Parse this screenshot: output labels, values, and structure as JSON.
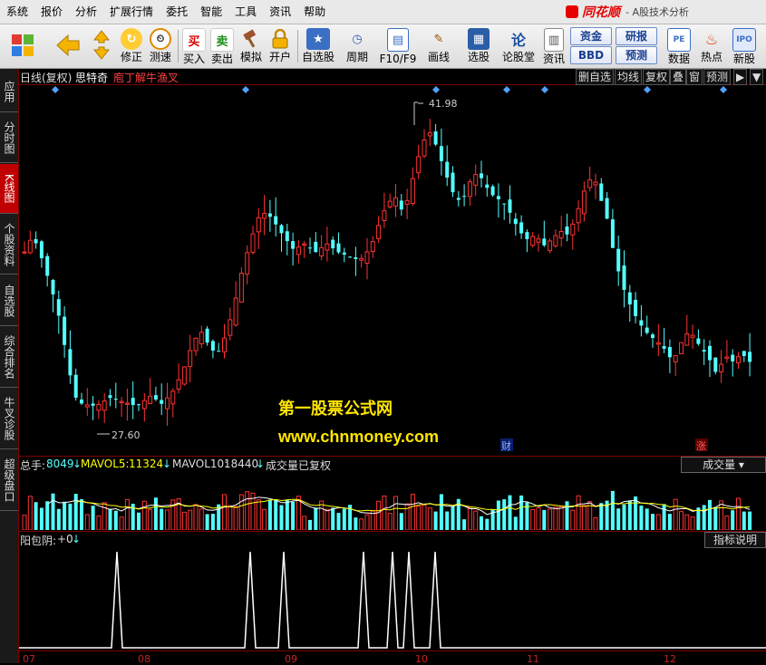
{
  "menu": {
    "items": [
      "系统",
      "报价",
      "分析",
      "扩展行情",
      "委托",
      "智能",
      "工具",
      "资讯",
      "帮助"
    ],
    "brand": "同花顺",
    "subtitle": "- A股技术分析"
  },
  "toolbar": {
    "buttons": [
      "修正",
      "测速",
      "买入",
      "卖出",
      "模拟",
      "开户",
      "自选股",
      "周期",
      "F10/F9",
      "画线",
      "选股",
      "论股堂",
      "资讯",
      "数据",
      "热点",
      "新股"
    ],
    "box_buttons": [
      "资金",
      "研报",
      "BBD",
      "预测"
    ]
  },
  "sidetabs": [
    "应用",
    "分时图",
    "K线图",
    "个股资料",
    "自选股",
    "综合排名",
    "牛叉诊股",
    "超级盘口"
  ],
  "kheader": {
    "period": "日线(复权)",
    "name": "思特奇",
    "formula": "庖丁解牛渔叉",
    "buttons": [
      "删自选",
      "均线",
      "复权",
      "叠",
      "窗",
      "预测"
    ],
    "expand": "▶",
    "more": "▼"
  },
  "annotations": {
    "high_label": "41.98",
    "low_label": "27.60",
    "cai_marker": "财",
    "zhang_marker": "涨"
  },
  "watermark": {
    "line1": "第一股票公式网",
    "line2": "www.chnmoney.com"
  },
  "volume_header": {
    "total_label": "总手:",
    "total_value": "8049",
    "ma5_label": "MAVOL5:",
    "ma5_value": "11324",
    "ma10_label": "MAVOL10:",
    "ma10_value": "18440",
    "note": "成交量已复权",
    "dropdown": "成交量"
  },
  "indicator_header": {
    "label": "阳包阴:",
    "value": "+0",
    "button": "指标说明"
  },
  "time_axis": [
    "07",
    "08",
    "09",
    "10",
    "11",
    "12"
  ],
  "colors": {
    "up": "#ff3232",
    "down": "#54ffff",
    "ma5": "#ffffff",
    "ma10": "#ffff00",
    "marker_diamond": "#4fa3ff",
    "accent_red": "#c00000"
  }
}
